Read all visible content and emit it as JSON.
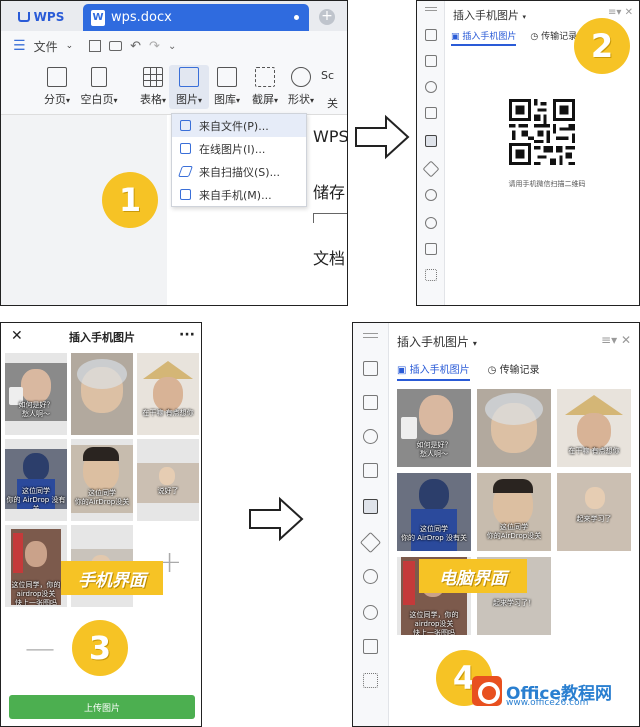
{
  "panel1": {
    "app_tab": "WPS",
    "doc_tab": "wps.docx",
    "file_menu": "文件",
    "ribbon": [
      {
        "label": "分页"
      },
      {
        "label": "空白页"
      },
      {
        "label": "表格"
      },
      {
        "label": "图片"
      },
      {
        "label": "图库"
      },
      {
        "label": "截屏"
      },
      {
        "label": "形状"
      }
    ],
    "ribbon_extra_1": "Sc",
    "ribbon_extra_2": "关",
    "dropdown": [
      "来自文件(P)...",
      "在线图片(I)...",
      "来自扫描仪(S)...",
      "来自手机(M)..."
    ],
    "doc_lines": [
      "WPS",
      "储存",
      "文档"
    ]
  },
  "panel2": {
    "title": "插入手机图片",
    "tab_insert": "插入手机图片",
    "tab_history": "传输记录",
    "qr_caption": "请用手机微信扫描二维码"
  },
  "panel3": {
    "close": "✕",
    "title": "插入手机图片",
    "more": "···",
    "banner": "手机界面",
    "upload_button": "上传图片",
    "captions": [
      "如何是好？\n愁人啊～",
      "在干嘛 有点想你",
      "这位同学\n你的 AirDrop 没有关",
      "这位同学\n你的AirDrop没关",
      "说好了",
      "这位同学，你的airdrop没关\n快上一张图吗"
    ]
  },
  "panel4": {
    "title": "插入手机图片",
    "tab_insert": "插入手机图片",
    "tab_history": "传输记录",
    "banner": "电脑界面",
    "captions": [
      "如何是好？\n愁人啊～",
      "在干嘛 有点想你",
      "这位同学\n你的 AirDrop 没有关",
      "这位同学\n你的AirDrop没关",
      "起来学习了",
      "这位同学，你的airdrop没关\n快上一张图吗",
      "起来学习了！"
    ]
  },
  "badges": [
    "1",
    "2",
    "3",
    "4"
  ],
  "watermark": {
    "name": "Office教程网",
    "url": "www.office26.com"
  },
  "colors": {
    "accent": "#f6c325",
    "wps_blue": "#2f6bdf",
    "upload_green": "#4caf50",
    "logo_orange": "#e8501f"
  }
}
